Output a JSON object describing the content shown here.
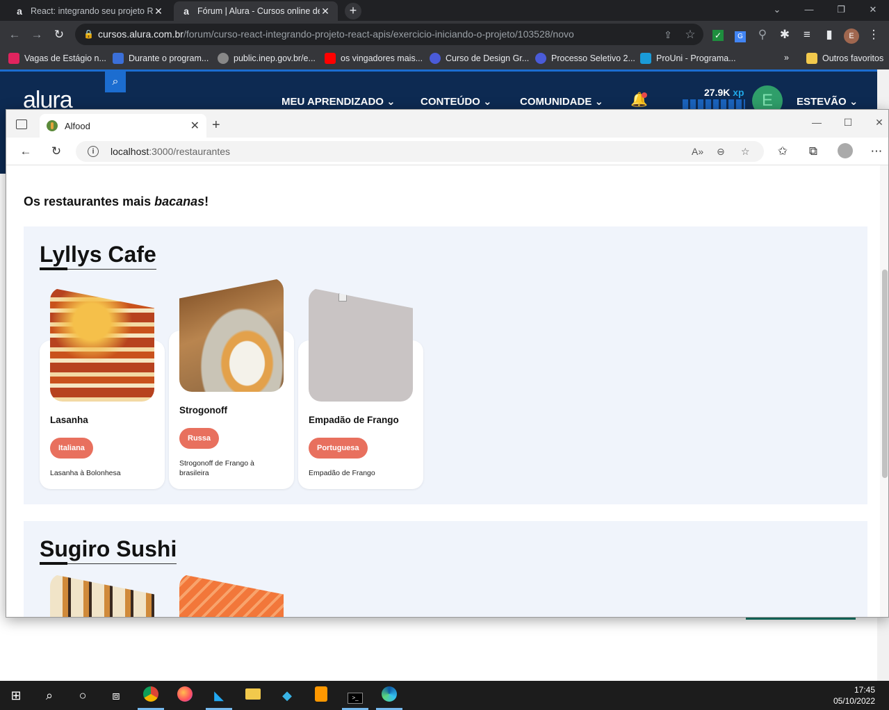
{
  "outer_browser": {
    "tabs": [
      {
        "title": "React: integrando seu projeto Re",
        "favicon": "a",
        "active": false
      },
      {
        "title": "Fórum | Alura - Cursos online de",
        "favicon": "a",
        "active": true
      }
    ],
    "url_host": "cursos.alura.com.br",
    "url_path": "/forum/curso-react-integrando-projeto-react-apis/exercicio-iniciando-o-projeto/103528/novo",
    "profile_initial": "E",
    "bookmarks": [
      {
        "label": "Vagas de Estágio n...",
        "color": "#e0245e"
      },
      {
        "label": "Durante o program...",
        "color": "#3b6fd8"
      },
      {
        "label": "public.inep.gov.br/e...",
        "color": "#888888"
      },
      {
        "label": "os vingadores mais...",
        "color": "#ff0000"
      },
      {
        "label": "Curso de Design Gr...",
        "color": "#4a5bd8"
      },
      {
        "label": "Processo Seletivo 2...",
        "color": "#4a5bd8"
      },
      {
        "label": "ProUni - Programa...",
        "color": "#1a9bd8"
      }
    ],
    "bookmarks_overflow": "»",
    "other_bookmarks": "Outros favoritos"
  },
  "alura": {
    "logo": "alura",
    "nav": [
      "MEU APRENDIZADO",
      "CONTEÚDO",
      "COMUNIDADE"
    ],
    "xp_value": "27.9K",
    "xp_unit": "xp",
    "avatar_initial": "E",
    "user_name": "ESTEVÃO"
  },
  "edge": {
    "tab_title": "Alfood",
    "url_host": "localhost",
    "url_path": ":3000/restaurantes"
  },
  "alfood": {
    "heading_pre": "Os restaurantes mais ",
    "heading_em": "bacanas",
    "heading_post": "!",
    "restaurants": [
      {
        "name": "Lyllys Cafe",
        "dishes": [
          {
            "name": "Lasanha",
            "tag": "Italiana",
            "description": "Lasanha à Bolonhesa"
          },
          {
            "name": "Strogonoff",
            "tag": "Russa",
            "description": "Strogonoff de Frango à brasileira"
          },
          {
            "name": "Empadão de Frango",
            "tag": "Portuguesa",
            "description": "Empadão de Frango"
          }
        ]
      },
      {
        "name": "Sugiro Sushi",
        "dishes": []
      }
    ]
  },
  "taskbar": {
    "time": "17:45",
    "date": "05/10/2022"
  }
}
